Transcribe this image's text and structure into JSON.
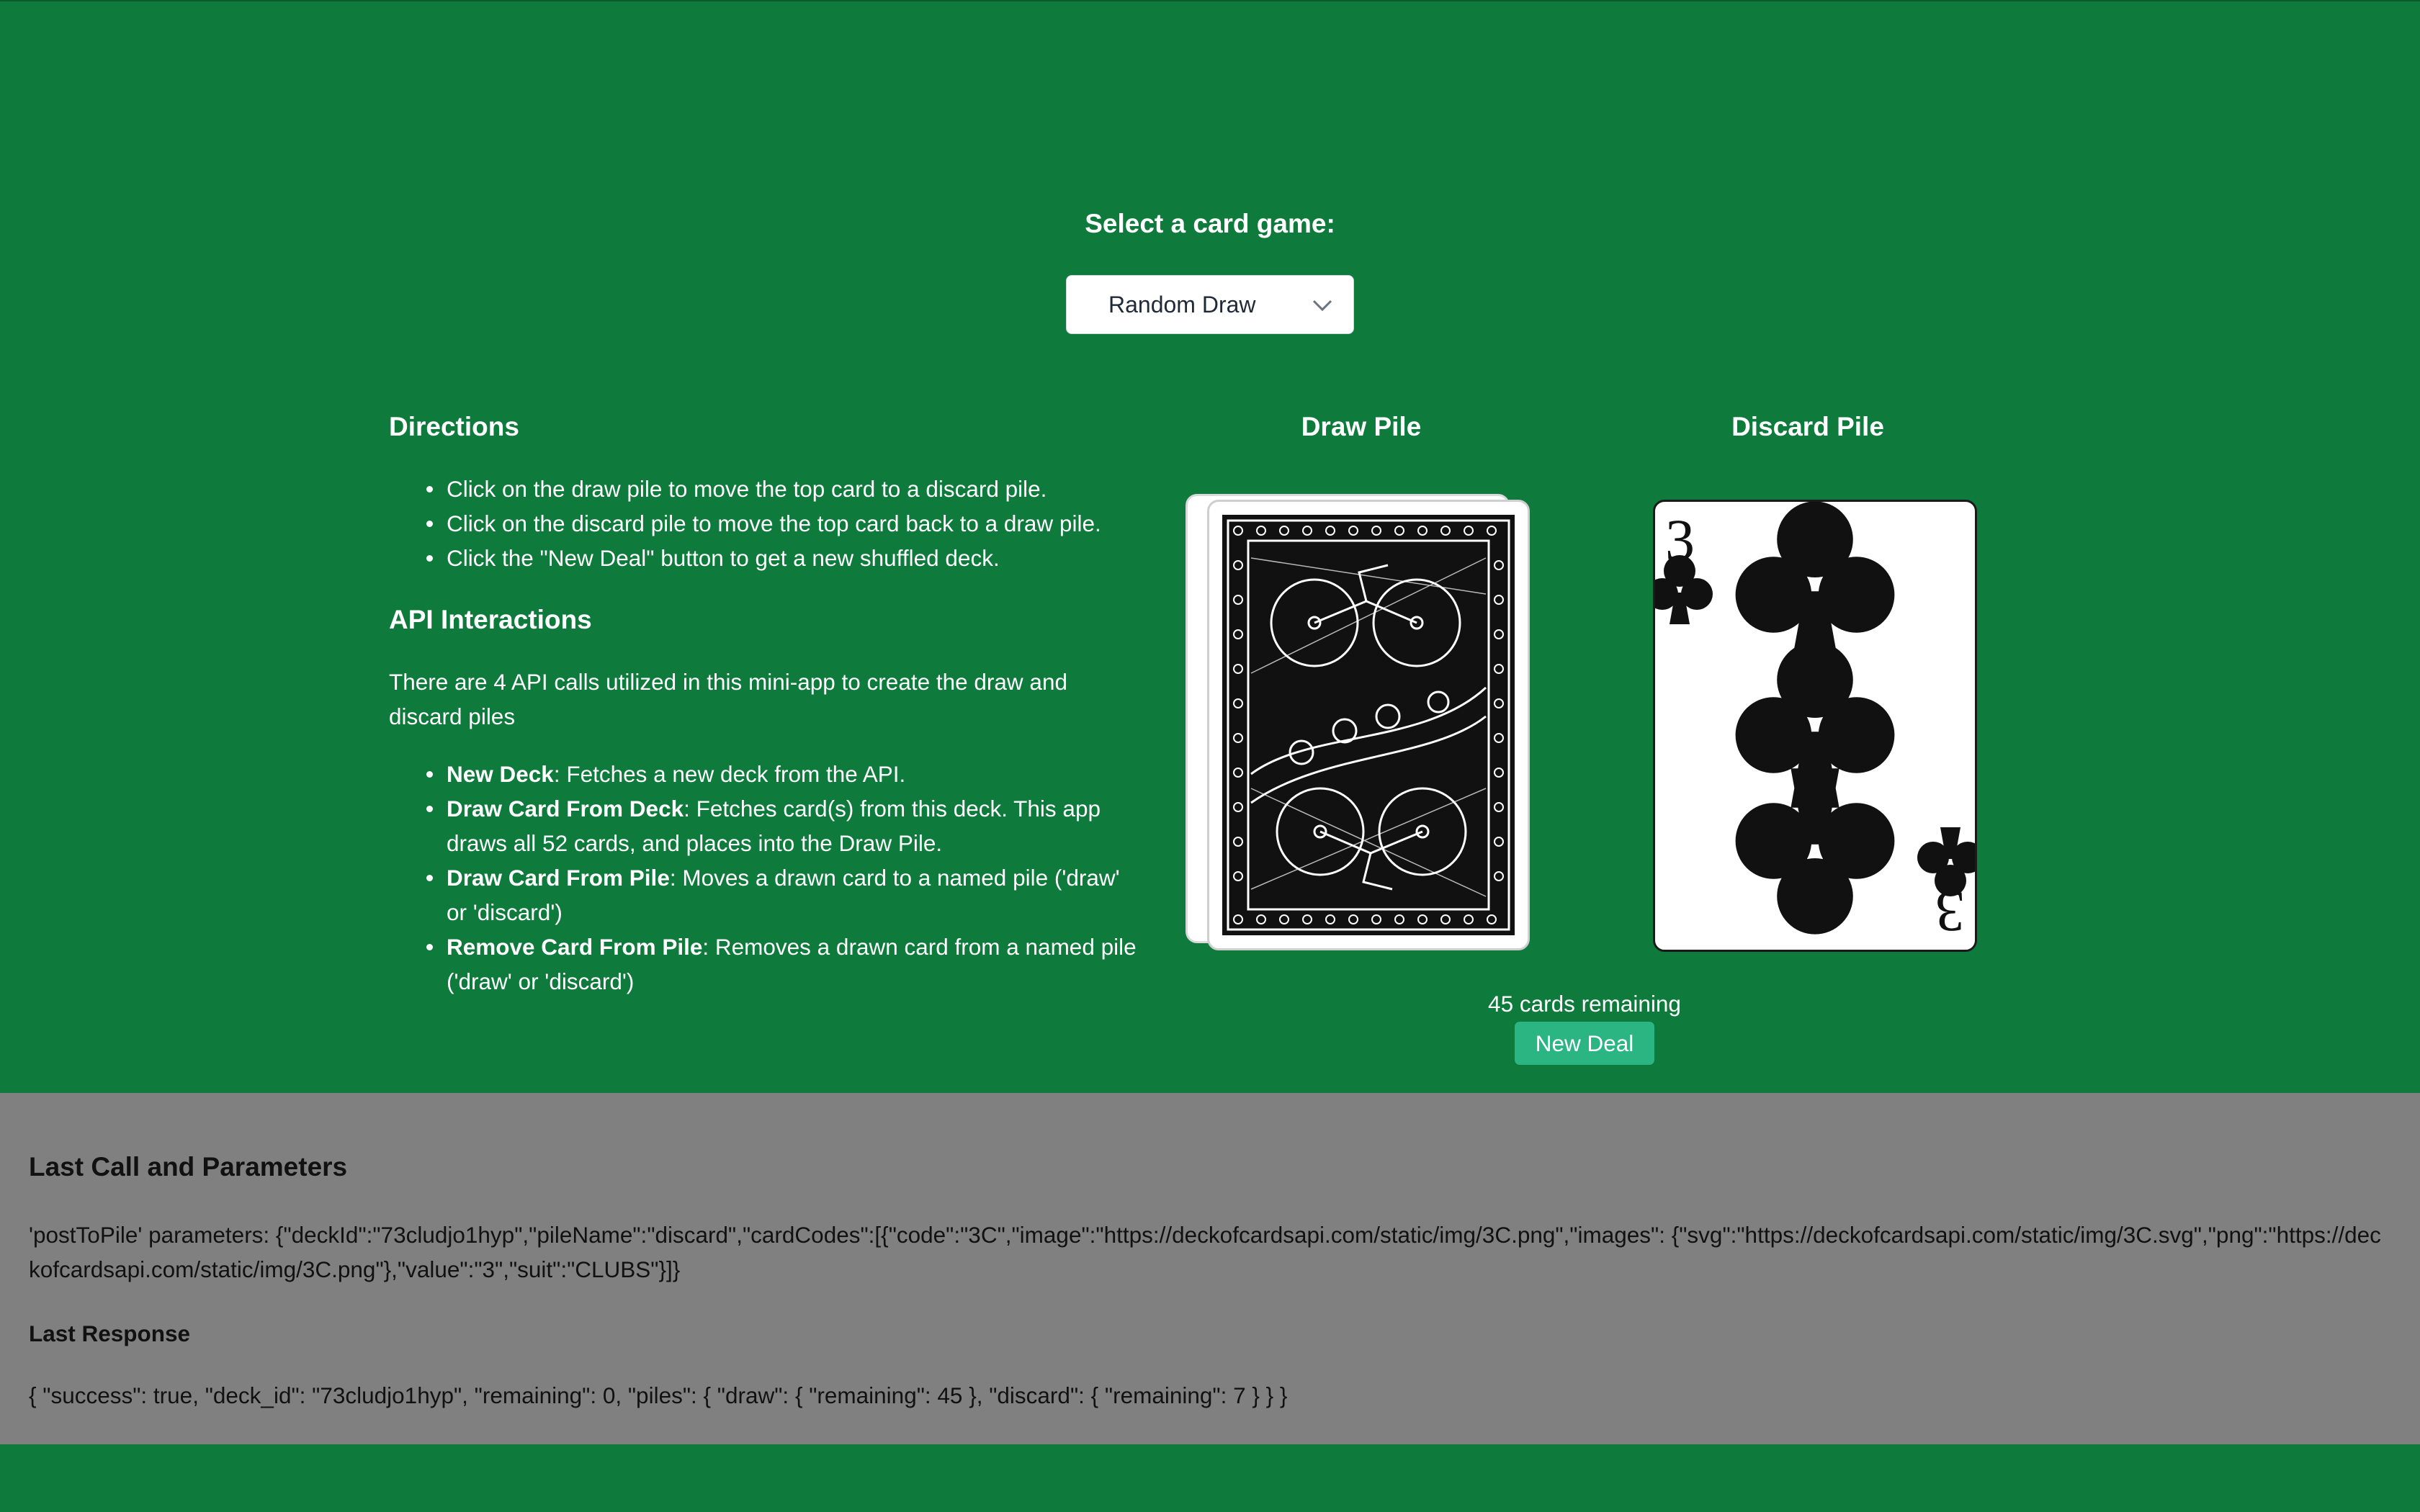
{
  "selector": {
    "label": "Select a card game:",
    "selected": "Random Draw"
  },
  "directions": {
    "title": "Directions",
    "items": [
      "Click on the draw pile to move the top card to a discard pile.",
      "Click on the discard pile to move the top card back to a draw pile.",
      "Click the \"New Deal\" button to get a new shuffled deck."
    ]
  },
  "api": {
    "title": "API Interactions",
    "intro": "There are 4 API calls utilized in this mini-app to create the draw and discard piles",
    "items": [
      {
        "name": "New Deck",
        "desc": ": Fetches a new deck from the API."
      },
      {
        "name": "Draw Card From Deck",
        "desc": ": Fetches card(s) from this deck. This app draws all 52 cards, and places into the Draw Pile."
      },
      {
        "name": "Draw Card From Pile",
        "desc": ": Moves a drawn card to a named pile ('draw' or 'discard')"
      },
      {
        "name": "Remove Card From Pile",
        "desc": ": Removes a drawn card from a named pile ('draw' or 'discard')"
      }
    ]
  },
  "piles": {
    "draw_title": "Draw Pile",
    "discard_title": "Discard Pile",
    "discard_top": {
      "rank": "3",
      "suit": "clubs"
    }
  },
  "deal": {
    "remaining_text": "45 cards remaining",
    "button_label": "New Deal"
  },
  "last_call": {
    "title": "Last Call and Parameters",
    "text": "'postToPile' parameters: {\"deckId\":\"73cludjo1hyp\",\"pileName\":\"discard\",\"cardCodes\":[{\"code\":\"3C\",\"image\":\"https://deckofcardsapi.com/static/img/3C.png\",\"images\": {\"svg\":\"https://deckofcardsapi.com/static/img/3C.svg\",\"png\":\"https://deckofcardsapi.com/static/img/3C.png\"},\"value\":\"3\",\"suit\":\"CLUBS\"}]}"
  },
  "last_response": {
    "title": "Last Response",
    "text": "{ \"success\": true, \"deck_id\": \"73cludjo1hyp\", \"remaining\": 0, \"piles\": { \"draw\": { \"remaining\": 45 }, \"discard\": { \"remaining\": 7 } } }"
  },
  "colors": {
    "table_green": "#0e7a3c",
    "panel_gray": "#808080",
    "button_teal": "#2bb583"
  },
  "icons": [
    "chevron-down-icon",
    "card-back-design",
    "club-suit-icon"
  ]
}
